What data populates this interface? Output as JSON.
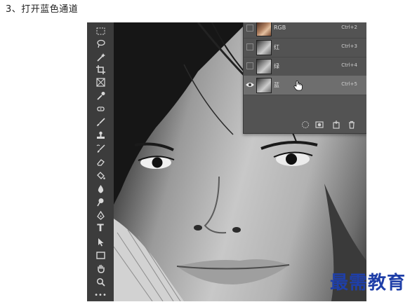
{
  "step_heading": "3、打开蓝色通道",
  "toolbar": {
    "tools": [
      {
        "name": "marquee-tool-icon"
      },
      {
        "name": "lasso-tool-icon"
      },
      {
        "name": "magic-wand-tool-icon"
      },
      {
        "name": "crop-tool-icon"
      },
      {
        "name": "frame-tool-icon"
      },
      {
        "name": "eyedropper-tool-icon"
      },
      {
        "name": "healing-brush-tool-icon"
      },
      {
        "name": "brush-tool-icon"
      },
      {
        "name": "clone-stamp-tool-icon"
      },
      {
        "name": "history-brush-tool-icon"
      },
      {
        "name": "eraser-tool-icon"
      },
      {
        "name": "paint-bucket-tool-icon"
      },
      {
        "name": "blur-tool-icon"
      },
      {
        "name": "dodge-tool-icon"
      },
      {
        "name": "pen-tool-icon"
      },
      {
        "name": "type-tool-icon",
        "glyph": "T"
      },
      {
        "name": "path-selection-tool-icon"
      },
      {
        "name": "rectangle-tool-icon"
      },
      {
        "name": "hand-tool-icon"
      },
      {
        "name": "zoom-tool-icon"
      },
      {
        "name": "more-tools-icon",
        "glyph": "•••"
      }
    ]
  },
  "channels_panel": {
    "rows": [
      {
        "name": "RGB",
        "shortcut": "Ctrl+2",
        "visible": false,
        "selected": false
      },
      {
        "name": "红",
        "shortcut": "Ctrl+3",
        "visible": false,
        "selected": false
      },
      {
        "name": "绿",
        "shortcut": "Ctrl+4",
        "visible": false,
        "selected": false
      },
      {
        "name": "蓝",
        "shortcut": "Ctrl+5",
        "visible": true,
        "selected": true
      }
    ],
    "footer_icons": [
      "load-selection-icon",
      "save-selection-icon",
      "new-channel-icon",
      "delete-channel-icon"
    ]
  },
  "watermark": "最需教育",
  "colors": {
    "panel_bg": "#535353",
    "toolbar_bg": "#3c3c3c",
    "selected_row": "#6e6e6e",
    "watermark": "#1f3fa8"
  }
}
